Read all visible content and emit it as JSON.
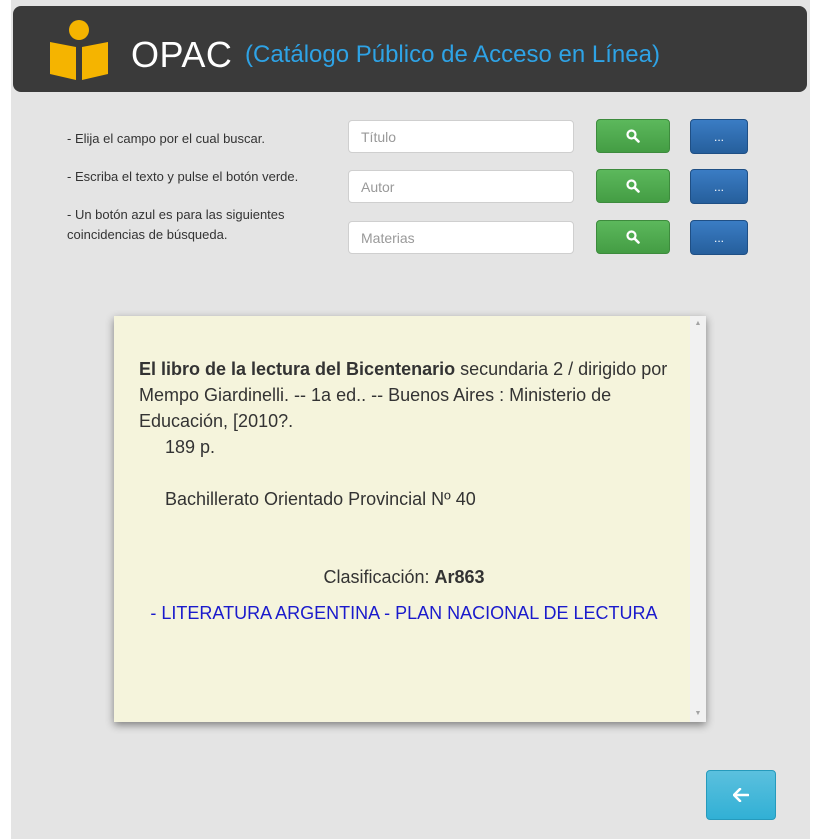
{
  "header": {
    "title": "OPAC",
    "subtitle": "(Catálogo Público de Acceso en Línea)",
    "logo_icon": "reader-book-icon",
    "logo_color": "#f5b400"
  },
  "instructions": [
    "- Elija el campo por el cual buscar.",
    "- Escriba el texto y pulse el botón verde.",
    "- Un botón azul es para las siguientes",
    "coincidencias de búsqueda."
  ],
  "search_rows": [
    {
      "placeholder": "Título",
      "value": "",
      "search_icon": "search-icon",
      "next_label": "..."
    },
    {
      "placeholder": "Autor",
      "value": "",
      "search_icon": "search-icon",
      "next_label": "..."
    },
    {
      "placeholder": "Materias",
      "value": "",
      "search_icon": "search-icon",
      "next_label": "..."
    }
  ],
  "result": {
    "title_bold": "El libro de la lectura del Bicentenario",
    "title_rest": " secundaria 2 / dirigido por Mempo Giardinelli. -- 1a ed.. -- Buenos Aires : Ministerio de Educación, [2010?.",
    "pages": "189 p.",
    "library": "Bachillerato Orientado Provincial Nº 40",
    "classification_label": "Clasificación: ",
    "classification_value": "Ar863",
    "subjects_sep": "- ",
    "subject_1": "LITERATURA ARGENTINA",
    "subject_2": "PLAN NACIONAL DE LECTURA"
  },
  "colors": {
    "header_bg": "#3a3a3a",
    "subtitle": "#2ea3e6",
    "search_button": "#5cb85c",
    "next_button": "#2d6fb5",
    "back_button": "#5bc0de",
    "result_bg": "#f5f4dc",
    "subject_link": "#1a1acc"
  },
  "back_button_icon": "arrow-left-icon"
}
